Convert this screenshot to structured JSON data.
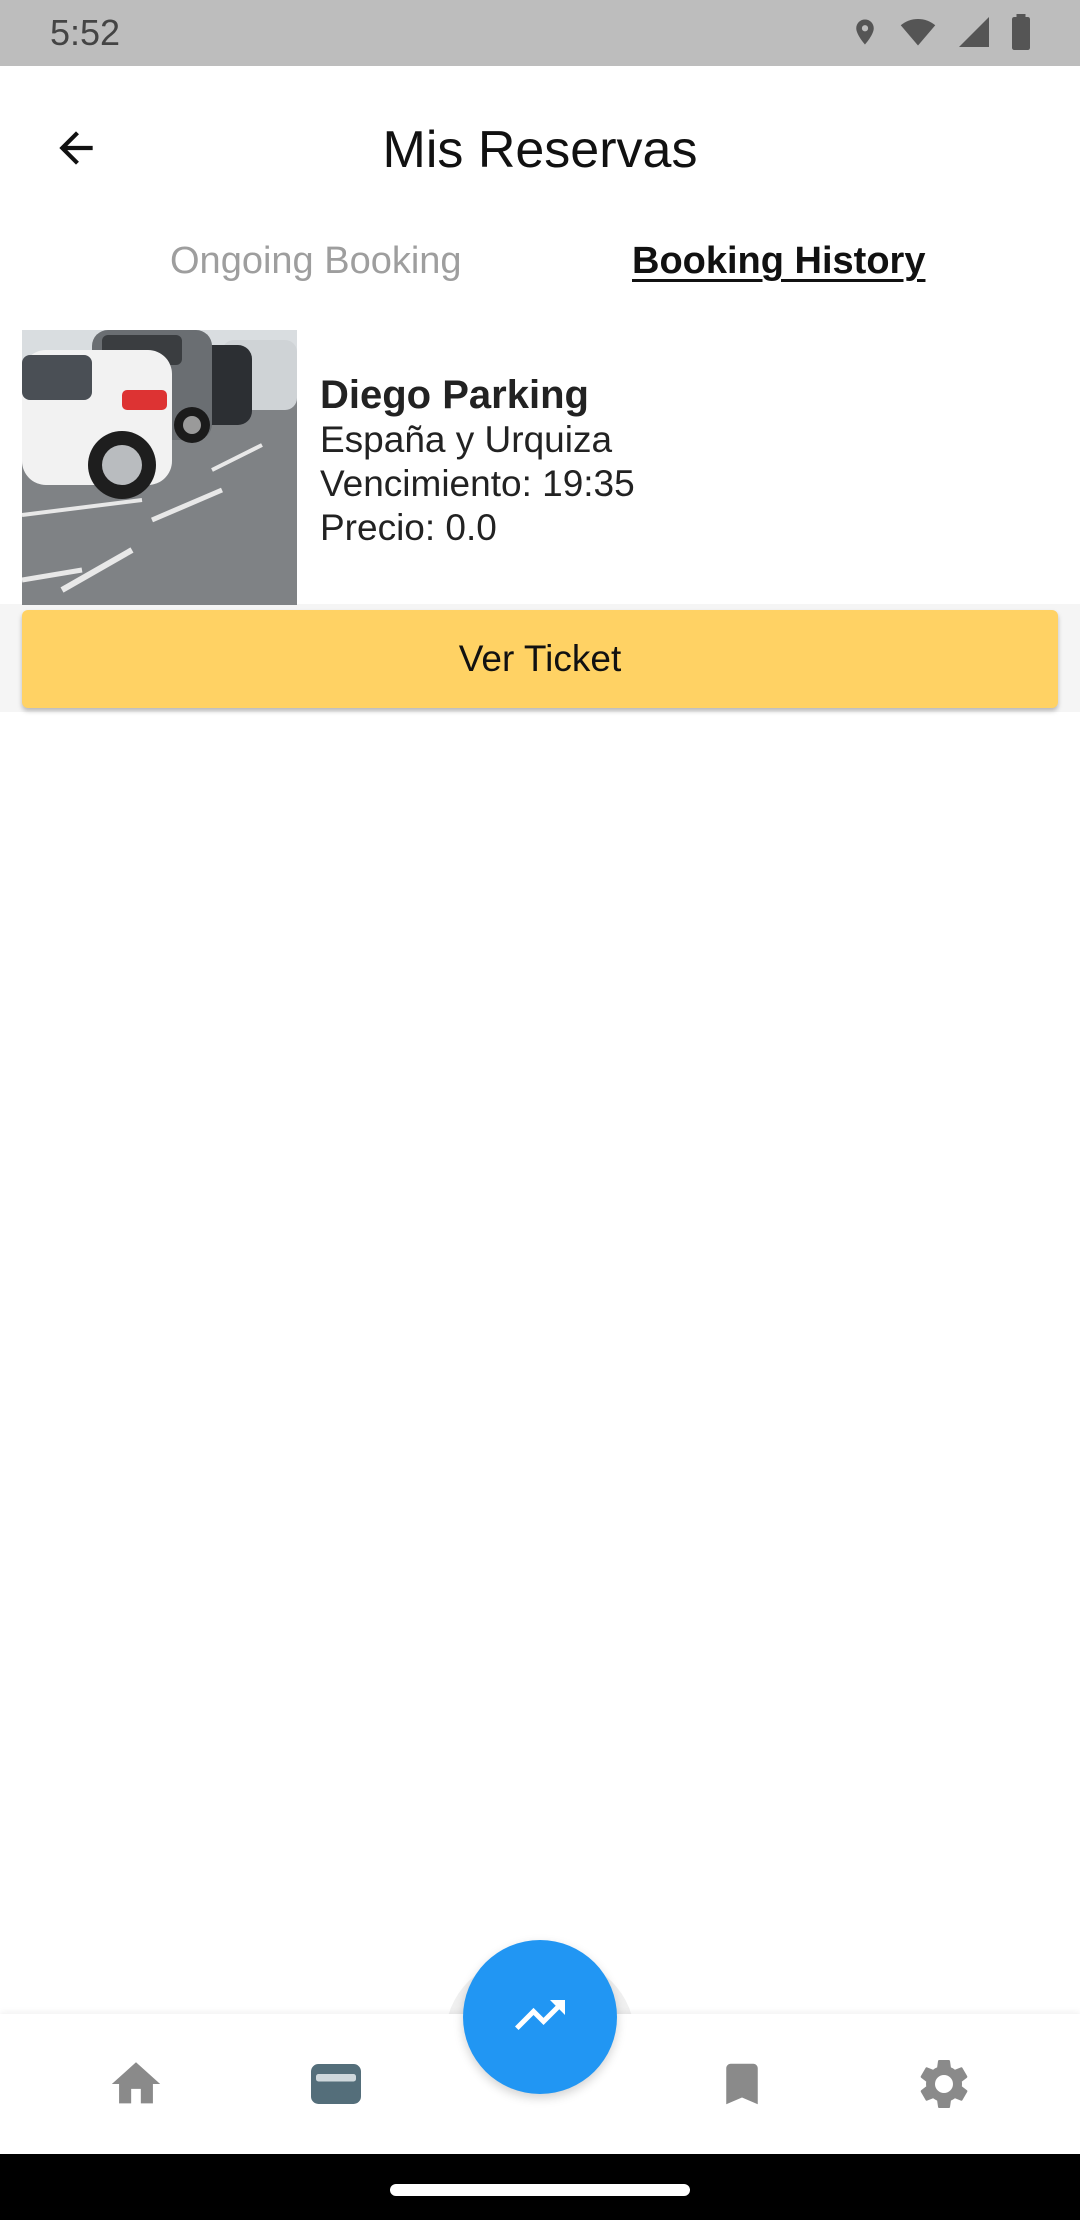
{
  "status_bar": {
    "time": "5:52",
    "icons": [
      "location-icon",
      "wifi-icon",
      "signal-icon",
      "battery-icon"
    ]
  },
  "header": {
    "title": "Mis Reservas",
    "back_icon": "arrow-back-icon"
  },
  "tabs": [
    {
      "label": "Ongoing Booking",
      "active": false
    },
    {
      "label": "Booking History",
      "active": true
    }
  ],
  "booking": {
    "name": "Diego Parking",
    "address": "España y Urquiza",
    "expiry": "Vencimiento: 19:35",
    "price": "Precio: 0.0",
    "button_label": "Ver Ticket",
    "image": "parking-lot-photo"
  },
  "bottom_nav": {
    "items": [
      "home-icon",
      "wallet-icon",
      "bookmark-icon",
      "settings-icon"
    ],
    "fab_icon": "trending-up-icon",
    "active_item": "wallet-icon"
  },
  "colors": {
    "accent_button": "#ffd264",
    "fab": "#2196f3",
    "nav_icon": "#8a8a8a",
    "nav_icon_active": "#546e7a"
  }
}
